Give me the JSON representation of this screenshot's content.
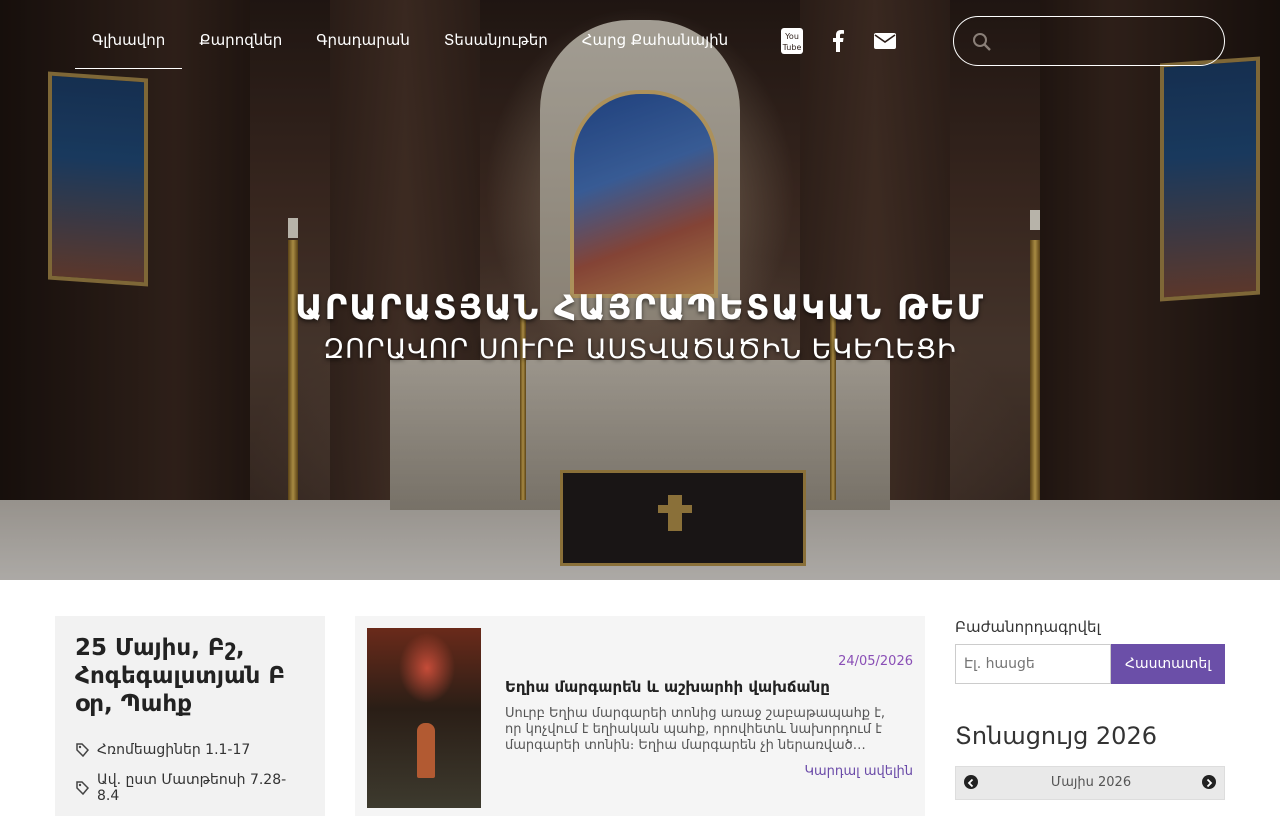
{
  "nav": {
    "items": [
      {
        "label": "Գլխավոր",
        "active": true
      },
      {
        "label": "Քարոզներ",
        "active": false
      },
      {
        "label": "Գրադարան",
        "active": false
      },
      {
        "label": "Տեսանյութեր",
        "active": false
      },
      {
        "label": "Հարց Քահանային",
        "active": false
      }
    ],
    "social": [
      "youtube-icon",
      "facebook-icon",
      "envelope-icon"
    ],
    "search_placeholder": ""
  },
  "hero": {
    "title": "ԱՐԱՐԱՏՅԱՆ ՀԱՅՐԱՊԵՏԱԿԱՆ ԹԵՄ",
    "subtitle": "ԶՈՐԱՎՈՐ ՍՈՒՐԲ ԱՍՏՎԱԾԱԾԻՆ ԵԿԵՂԵՑԻ"
  },
  "day": {
    "title": "25 Մայիս, Բշ, Հոգեգալստյան Բ օր, Պահք",
    "readings": [
      "Հռոմեացիներ 1.1-17",
      "Ավ. ըստ Մատթեոսի 7.28-8.4"
    ]
  },
  "post": {
    "date": "24/05/2026",
    "title": "Եղիա մարգարեն և աշխարհի վախճանը",
    "excerpt": "Սուրբ Եղիա մարգարեի տոնից առաջ շաբաթապահք է, որ կոչվում է եղիական պահք, որովհետև նախորդում է մարգարեի տոնին։ Եղիա մարգարեն չի ներառված…",
    "more": "Կարդալ ավելին"
  },
  "subscribe": {
    "label": "Բաժանորդագրվել",
    "placeholder": "Էլ. հասցե",
    "button": "Հաստատել"
  },
  "calendar": {
    "title": "Տոնացույց 2026",
    "month": "Մայիս 2026"
  }
}
